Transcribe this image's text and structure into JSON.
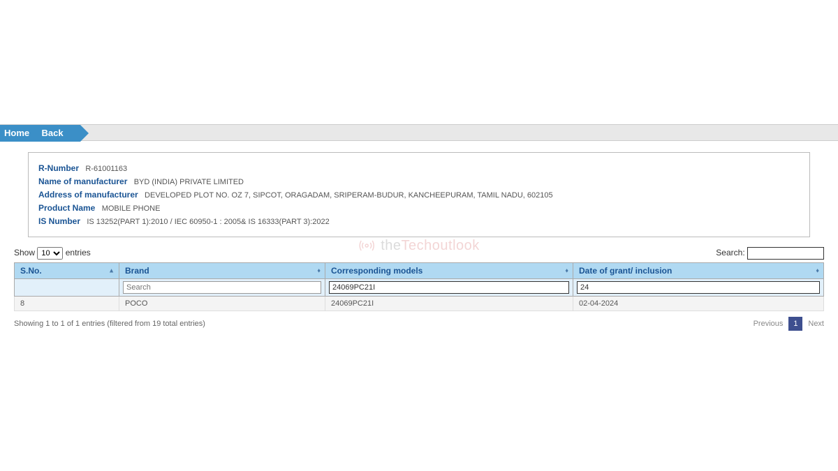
{
  "nav": {
    "home": "Home",
    "back": "Back"
  },
  "details": {
    "rnumber_label": "R-Number",
    "rnumber_value": "R-61001163",
    "manufacturer_label": "Name of manufacturer",
    "manufacturer_value": "BYD (INDIA) PRIVATE LIMITED",
    "address_label": "Address of manufacturer",
    "address_value": "DEVELOPED PLOT NO. OZ 7, SIPCOT, ORAGADAM, SRIPERAM-BUDUR, KANCHEEPURAM, TAMIL NADU, 602105",
    "product_label": "Product Name",
    "product_value": "MOBILE PHONE",
    "isnumber_label": "IS Number",
    "isnumber_value": "IS 13252(PART 1):2010 / IEC 60950-1 : 2005& IS 16333(PART 3):2022"
  },
  "controls": {
    "show_label": "Show",
    "entries_label": "entries",
    "entries_selected": "10",
    "search_label": "Search:",
    "search_value": ""
  },
  "table": {
    "headers": {
      "sno": "S.No.",
      "brand": "Brand",
      "models": "Corresponding models",
      "date": "Date of grant/ inclusion"
    },
    "filters": {
      "sno": "",
      "brand_placeholder": "Search",
      "brand": "",
      "models": "24069PC21I",
      "date": "24"
    },
    "rows": [
      {
        "sno": "8",
        "brand": "POCO",
        "models": "24069PC21I",
        "date": "02-04-2024"
      }
    ]
  },
  "footer": {
    "info": "Showing 1 to 1 of 1 entries (filtered from 19 total entries)",
    "previous": "Previous",
    "current_page": "1",
    "next": "Next"
  },
  "watermark": {
    "text_prefix": "the",
    "text_main": "Techoutlook"
  }
}
